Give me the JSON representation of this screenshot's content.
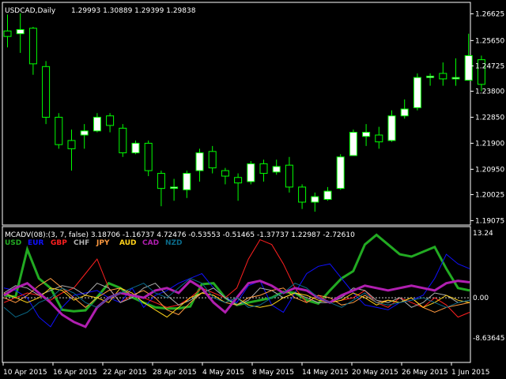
{
  "symbol_header": {
    "symbol": "USDCAD,Daily",
    "ohlc": "1.29993 1.30889 1.29399 1.29838"
  },
  "price_axis": {
    "ticks": [
      "1.26625",
      "1.25650",
      "1.24725",
      "1.23800",
      "1.22850",
      "1.21900",
      "1.20950",
      "1.20025",
      "1.19075"
    ]
  },
  "indicator": {
    "header": "MCADV(08):(3, 7, false) 3.18706 -1.16737 4.72476 -0.53553 -0.51465 -1.37737 1.22987 -2.72610",
    "max_label": "13.24",
    "zero_label": "0.00",
    "min_label": "-8.63645",
    "currencies": [
      {
        "name": "USD",
        "color": "#22aa22"
      },
      {
        "name": "EUR",
        "color": "#1010ff"
      },
      {
        "name": "GBP",
        "color": "#ff2020"
      },
      {
        "name": "CHF",
        "color": "#b0b0b0"
      },
      {
        "name": "JPY",
        "color": "#ff9a40"
      },
      {
        "name": "AUD",
        "color": "#ffd21a"
      },
      {
        "name": "CAD",
        "color": "#b01fb0"
      },
      {
        "name": "NZD",
        "color": "#0b6b8a"
      }
    ]
  },
  "time_axis": {
    "labels": [
      "10 Apr 2015",
      "16 Apr 2015",
      "22 Apr 2015",
      "28 Apr 2015",
      "4 May 2015",
      "8 May 2015",
      "14 May 2015",
      "20 May 2015",
      "26 May 2015",
      "1 Jun 2015"
    ]
  },
  "colors": {
    "background": "#000000",
    "foreground": "#ffffff",
    "bull_candle": "#ffffff",
    "bear_candle": "#000000",
    "wick": "#00ff00",
    "zero_line": "#c8c8c8"
  },
  "chart_data": [
    {
      "type": "candlestick",
      "title": "USDCAD,Daily",
      "ylim": [
        1.19,
        1.269
      ],
      "candles": [
        {
          "o": 1.26,
          "h": 1.266,
          "l": 1.254,
          "c": 1.258
        },
        {
          "o": 1.259,
          "h": 1.2665,
          "l": 1.252,
          "c": 1.2605
        },
        {
          "o": 1.261,
          "h": 1.2615,
          "l": 1.244,
          "c": 1.248
        },
        {
          "o": 1.247,
          "h": 1.249,
          "l": 1.226,
          "c": 1.2285
        },
        {
          "o": 1.2285,
          "h": 1.23,
          "l": 1.217,
          "c": 1.2185
        },
        {
          "o": 1.22,
          "h": 1.224,
          "l": 1.209,
          "c": 1.217
        },
        {
          "o": 1.222,
          "h": 1.226,
          "l": 1.217,
          "c": 1.2235
        },
        {
          "o": 1.2235,
          "h": 1.23,
          "l": 1.223,
          "c": 1.2285
        },
        {
          "o": 1.229,
          "h": 1.23,
          "l": 1.223,
          "c": 1.2255
        },
        {
          "o": 1.2245,
          "h": 1.226,
          "l": 1.214,
          "c": 1.2155
        },
        {
          "o": 1.2155,
          "h": 1.22,
          "l": 1.215,
          "c": 1.219
        },
        {
          "o": 1.219,
          "h": 1.22,
          "l": 1.207,
          "c": 1.209
        },
        {
          "o": 1.208,
          "h": 1.209,
          "l": 1.196,
          "c": 1.2025
        },
        {
          "o": 1.2025,
          "h": 1.206,
          "l": 1.198,
          "c": 1.203
        },
        {
          "o": 1.202,
          "h": 1.209,
          "l": 1.199,
          "c": 1.208
        },
        {
          "o": 1.209,
          "h": 1.217,
          "l": 1.205,
          "c": 1.2155
        },
        {
          "o": 1.216,
          "h": 1.218,
          "l": 1.208,
          "c": 1.21
        },
        {
          "o": 1.209,
          "h": 1.21,
          "l": 1.204,
          "c": 1.207
        },
        {
          "o": 1.2065,
          "h": 1.208,
          "l": 1.198,
          "c": 1.2045
        },
        {
          "o": 1.205,
          "h": 1.2125,
          "l": 1.204,
          "c": 1.2115
        },
        {
          "o": 1.2115,
          "h": 1.213,
          "l": 1.205,
          "c": 1.208
        },
        {
          "o": 1.2085,
          "h": 1.213,
          "l": 1.2075,
          "c": 1.2105
        },
        {
          "o": 1.211,
          "h": 1.214,
          "l": 1.201,
          "c": 1.203
        },
        {
          "o": 1.203,
          "h": 1.204,
          "l": 1.195,
          "c": 1.1975
        },
        {
          "o": 1.1975,
          "h": 1.201,
          "l": 1.194,
          "c": 1.1995
        },
        {
          "o": 1.1985,
          "h": 1.203,
          "l": 1.198,
          "c": 1.2015
        },
        {
          "o": 1.2025,
          "h": 1.215,
          "l": 1.202,
          "c": 1.214
        },
        {
          "o": 1.2145,
          "h": 1.224,
          "l": 1.2145,
          "c": 1.223
        },
        {
          "o": 1.2215,
          "h": 1.226,
          "l": 1.218,
          "c": 1.223
        },
        {
          "o": 1.222,
          "h": 1.225,
          "l": 1.217,
          "c": 1.2195
        },
        {
          "o": 1.22,
          "h": 1.231,
          "l": 1.2195,
          "c": 1.229
        },
        {
          "o": 1.229,
          "h": 1.235,
          "l": 1.228,
          "c": 1.2315
        },
        {
          "o": 1.232,
          "h": 1.2445,
          "l": 1.231,
          "c": 1.243
        },
        {
          "o": 1.243,
          "h": 1.2445,
          "l": 1.24,
          "c": 1.2435
        },
        {
          "o": 1.2445,
          "h": 1.2485,
          "l": 1.24,
          "c": 1.2425
        },
        {
          "o": 1.2425,
          "h": 1.25,
          "l": 1.24,
          "c": 1.243
        },
        {
          "o": 1.242,
          "h": 1.259,
          "l": 1.242,
          "c": 1.251
        },
        {
          "o": 1.2495,
          "h": 1.251,
          "l": 1.238,
          "c": 1.2405
        }
      ]
    },
    {
      "type": "line",
      "title": "MCADV(08):(3, 7, false)",
      "ylim": [
        -8.63645,
        13.24
      ],
      "series": [
        {
          "name": "USD",
          "values": [
            0.5,
            0.2,
            10.0,
            4.0,
            2.0,
            -2.5,
            -2.8,
            -2.6,
            0.1,
            3.0,
            2.0,
            0.1,
            -1.0,
            -2.0,
            -2.2,
            -2.2,
            -1.8,
            2.8,
            3.0,
            0.0,
            -1.5,
            -1.0,
            -0.5,
            0.0,
            1.2,
            1.0,
            -0.5,
            -1.2,
            1.5,
            4.0,
            5.5,
            11.0,
            13.0,
            11.0,
            9.0,
            8.5,
            9.5,
            10.5,
            6.0,
            2.0,
            1.5
          ]
        },
        {
          "name": "EUR",
          "values": [
            2.0,
            1.5,
            0.0,
            -4.0,
            -6.0,
            -2.0,
            0.5,
            1.0,
            1.5,
            0.0,
            -1.0,
            2.0,
            -2.0,
            0.5,
            1.5,
            3.0,
            4.0,
            5.0,
            2.0,
            0.0,
            -1.0,
            2.5,
            3.5,
            -1.5,
            -3.0,
            1.0,
            5.0,
            6.5,
            7.0,
            4.0,
            1.0,
            -1.5,
            -2.0,
            -2.5,
            -1.0,
            -0.5,
            0.5,
            4.0,
            9.0,
            7.0,
            6.0
          ]
        },
        {
          "name": "GBP",
          "values": [
            -1.0,
            0.0,
            1.0,
            0.5,
            -0.5,
            1.0,
            2.0,
            5.0,
            8.0,
            2.0,
            -1.0,
            0.5,
            0.0,
            -1.0,
            -2.0,
            -1.5,
            0.0,
            2.0,
            1.0,
            0.0,
            2.0,
            8.0,
            12.0,
            11.0,
            7.0,
            2.0,
            -1.0,
            0.5,
            -1.0,
            -0.5,
            0.0,
            1.5,
            -1.0,
            -2.0,
            0.0,
            -1.0,
            -2.0,
            0.0,
            -1.5,
            -4.0,
            -3.0
          ]
        },
        {
          "name": "CHF",
          "values": [
            1.0,
            2.5,
            2.0,
            0.5,
            1.5,
            2.5,
            2.0,
            0.5,
            3.0,
            2.0,
            -1.0,
            0.0,
            2.0,
            3.0,
            0.5,
            -1.5,
            -0.5,
            1.0,
            2.0,
            0.0,
            -1.5,
            -0.5,
            2.0,
            1.5,
            0.0,
            1.0,
            0.0,
            -1.0,
            -1.0,
            0.0,
            2.0,
            1.5,
            -0.5,
            -1.0,
            0.0,
            -2.0,
            -1.0,
            1.0,
            0.5,
            -1.0,
            -0.5
          ]
        },
        {
          "name": "JPY",
          "values": [
            0.0,
            -1.0,
            0.5,
            2.5,
            4.0,
            2.0,
            0.0,
            -2.0,
            0.0,
            1.5,
            2.0,
            0.5,
            1.5,
            0.0,
            -2.5,
            -3.5,
            -1.0,
            1.0,
            0.5,
            -1.0,
            -1.5,
            0.0,
            0.5,
            1.5,
            2.0,
            0.0,
            -1.0,
            0.5,
            0.0,
            -1.5,
            -1.0,
            0.5,
            -1.0,
            -0.5,
            -1.0,
            0.0,
            -2.0,
            -3.0,
            -2.0,
            -1.5,
            -1.0
          ]
        },
        {
          "name": "AUD",
          "values": [
            1.0,
            0.0,
            -1.0,
            0.0,
            2.0,
            1.5,
            -0.5,
            0.5,
            0.0,
            -1.0,
            2.0,
            1.0,
            -1.0,
            -2.5,
            -4.0,
            -2.0,
            0.0,
            1.0,
            0.5,
            -1.0,
            0.0,
            -1.5,
            -2.0,
            -1.5,
            0.0,
            1.0,
            0.5,
            -0.5,
            -1.0,
            -0.5,
            1.0,
            0.0,
            -1.5,
            -0.5,
            -1.0,
            0.0,
            -2.0,
            -1.0,
            0.5,
            -0.5,
            -1.0
          ]
        },
        {
          "name": "CAD",
          "values": [
            0.5,
            2.0,
            3.0,
            1.0,
            -1.0,
            -3.5,
            -5.0,
            -6.0,
            -2.0,
            0.0,
            1.0,
            0.5,
            0.0,
            1.5,
            2.0,
            1.0,
            3.5,
            2.0,
            -1.0,
            -3.0,
            0.0,
            3.0,
            3.5,
            2.5,
            1.0,
            2.0,
            1.5,
            0.0,
            -1.0,
            0.5,
            1.5,
            2.5,
            2.0,
            1.5,
            2.0,
            2.5,
            2.0,
            1.5,
            3.0,
            3.5,
            3.2
          ]
        },
        {
          "name": "NZD",
          "values": [
            -2.0,
            -4.0,
            -3.0,
            -1.0,
            0.0,
            2.0,
            1.0,
            -1.0,
            -2.0,
            0.0,
            1.0,
            2.0,
            3.0,
            1.0,
            0.0,
            2.0,
            4.0,
            3.0,
            0.0,
            -1.0,
            0.0,
            -2.0,
            -1.5,
            0.0,
            1.0,
            3.0,
            2.0,
            0.0,
            -1.0,
            -2.0,
            -0.5,
            1.0,
            -1.0,
            -1.5,
            -1.0,
            -0.5,
            0.0,
            -1.0,
            -2.0,
            -1.0,
            -0.5
          ]
        }
      ]
    }
  ]
}
